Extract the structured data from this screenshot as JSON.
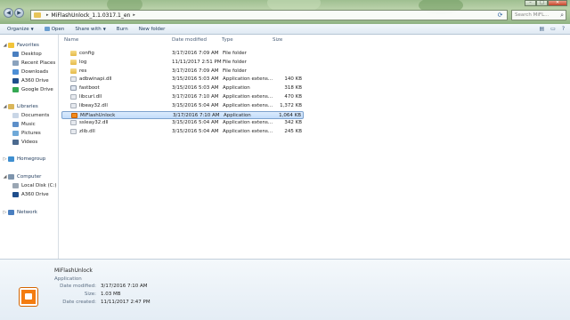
{
  "address": {
    "crumbs": [
      "MiFlashUnlock_1.1.0317.1_en"
    ],
    "search_placeholder": "Search MiFL..."
  },
  "toolbar": {
    "organize": "Organize",
    "open": "Open",
    "share_with": "Share with",
    "burn": "Burn",
    "new_folder": "New folder"
  },
  "nav": {
    "favorites": "Favorites",
    "desktop": "Desktop",
    "recent_places": "Recent Places",
    "downloads": "Downloads",
    "a360_drive": "A360 Drive",
    "google_drive": "Google Drive",
    "libraries": "Libraries",
    "documents": "Documents",
    "music": "Music",
    "pictures": "Pictures",
    "videos": "Videos",
    "homegroup": "Homegroup",
    "computer": "Computer",
    "local_disk": "Local Disk (C:)",
    "computer_a360": "A360 Drive",
    "network": "Network"
  },
  "columns": {
    "name": "Name",
    "date": "Date modified",
    "type": "Type",
    "size": "Size"
  },
  "files": [
    {
      "name": "config",
      "date": "3/17/2016 7:09 AM",
      "type": "File folder",
      "size": "",
      "kind": "folder"
    },
    {
      "name": "log",
      "date": "11/11/2017 2:51 PM",
      "type": "File folder",
      "size": "",
      "kind": "folder"
    },
    {
      "name": "res",
      "date": "3/17/2016 7:09 AM",
      "type": "File folder",
      "size": "",
      "kind": "folder"
    },
    {
      "name": "adbwinapi.dll",
      "date": "3/15/2016 5:03 AM",
      "type": "Application extens...",
      "size": "140 KB",
      "kind": "dll"
    },
    {
      "name": "fastboot",
      "date": "3/15/2016 5:03 AM",
      "type": "Application",
      "size": "318 KB",
      "kind": "app"
    },
    {
      "name": "libcurl.dll",
      "date": "3/17/2016 7:10 AM",
      "type": "Application extens...",
      "size": "470 KB",
      "kind": "dll"
    },
    {
      "name": "libeay32.dll",
      "date": "3/15/2016 5:04 AM",
      "type": "Application extens...",
      "size": "1,372 KB",
      "kind": "dll"
    },
    {
      "name": "MiFlashUnlock",
      "date": "3/17/2016 7:10 AM",
      "type": "Application",
      "size": "1,064 KB",
      "kind": "mi"
    },
    {
      "name": "ssleay32.dll",
      "date": "3/15/2016 5:04 AM",
      "type": "Application extens...",
      "size": "342 KB",
      "kind": "dll"
    },
    {
      "name": "zlib.dll",
      "date": "3/15/2016 5:04 AM",
      "type": "Application extens...",
      "size": "245 KB",
      "kind": "dll"
    }
  ],
  "details": {
    "name": "MiFlashUnlock",
    "type": "Application",
    "date_modified_label": "Date modified:",
    "date_modified": "3/17/2016 7:10 AM",
    "size_label": "Size:",
    "size": "1.03 MB",
    "date_created_label": "Date created:",
    "date_created": "11/11/2017 2:47 PM"
  },
  "colors": {
    "selection": "#c1dcfb",
    "aero_green": "#a9c59a",
    "mi_orange": "#f47c10"
  }
}
